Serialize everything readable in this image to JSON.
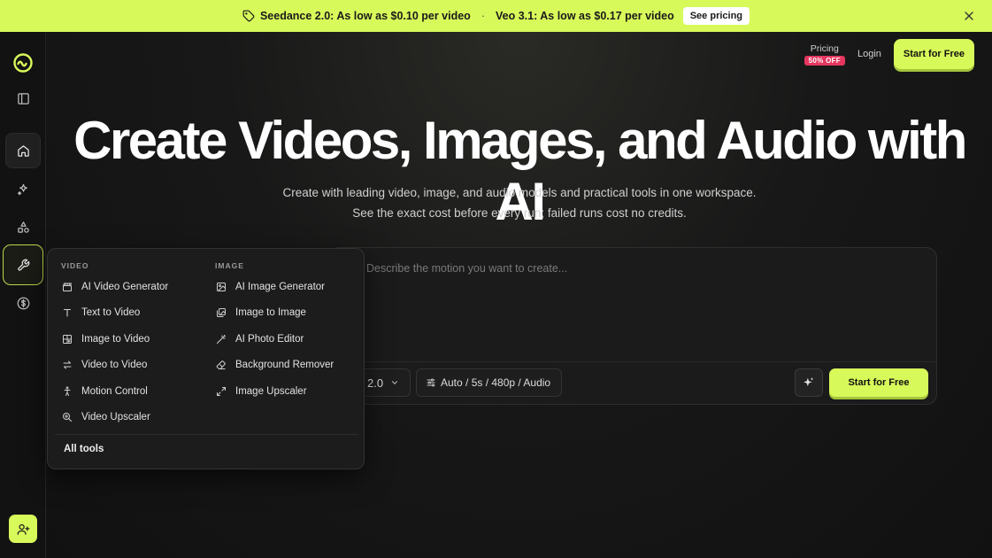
{
  "banner": {
    "promo1": "Seedance 2.0: As low as $0.10 per video",
    "separator": "·",
    "promo2": "Veo 3.1: As low as $0.17 per video",
    "cta": "See pricing"
  },
  "sidebar": {
    "items": [
      {
        "icon": "logo-icon"
      },
      {
        "icon": "panel-toggle-icon"
      },
      {
        "icon": "home-icon"
      },
      {
        "icon": "sparkles-icon"
      },
      {
        "icon": "shapes-icon"
      },
      {
        "icon": "wrench-icon"
      },
      {
        "icon": "dollar-icon"
      },
      {
        "icon": "add-user-icon"
      }
    ]
  },
  "header": {
    "pricing": "Pricing",
    "discount": "50% OFF",
    "login": "Login",
    "start": "Start for Free"
  },
  "hero": {
    "title": "Create Videos, Images, and Audio with AI",
    "subtitle_line1": "Create with leading video, image, and audio models and practical tools in one workspace.",
    "subtitle_line2": "See the exact cost before every run; failed runs cost no credits."
  },
  "prompt": {
    "placeholder": "Describe the motion you want to create...",
    "model": "2.0",
    "settings": "Auto / 5s / 480p / Audio",
    "start": "Start for Free"
  },
  "tools_menu": {
    "video_heading": "VIDEO",
    "video_items": [
      {
        "label": "AI Video Generator",
        "icon": "clapperboard-icon"
      },
      {
        "label": "Text to Video",
        "icon": "text-icon"
      },
      {
        "label": "Image to Video",
        "icon": "image-video-icon"
      },
      {
        "label": "Video to Video",
        "icon": "swap-icon"
      },
      {
        "label": "Motion Control",
        "icon": "person-icon"
      },
      {
        "label": "Video Upscaler",
        "icon": "zoom-icon"
      }
    ],
    "image_heading": "IMAGE",
    "image_items": [
      {
        "label": "AI Image Generator",
        "icon": "image-icon"
      },
      {
        "label": "Image to Image",
        "icon": "images-icon"
      },
      {
        "label": "AI Photo Editor",
        "icon": "wand-icon"
      },
      {
        "label": "Background Remover",
        "icon": "eraser-icon"
      },
      {
        "label": "Image Upscaler",
        "icon": "expand-icon"
      }
    ],
    "all_tools": "All tools"
  },
  "colors": {
    "accent": "#d8f95a",
    "background": "#141414",
    "badge": "#e5365f"
  }
}
